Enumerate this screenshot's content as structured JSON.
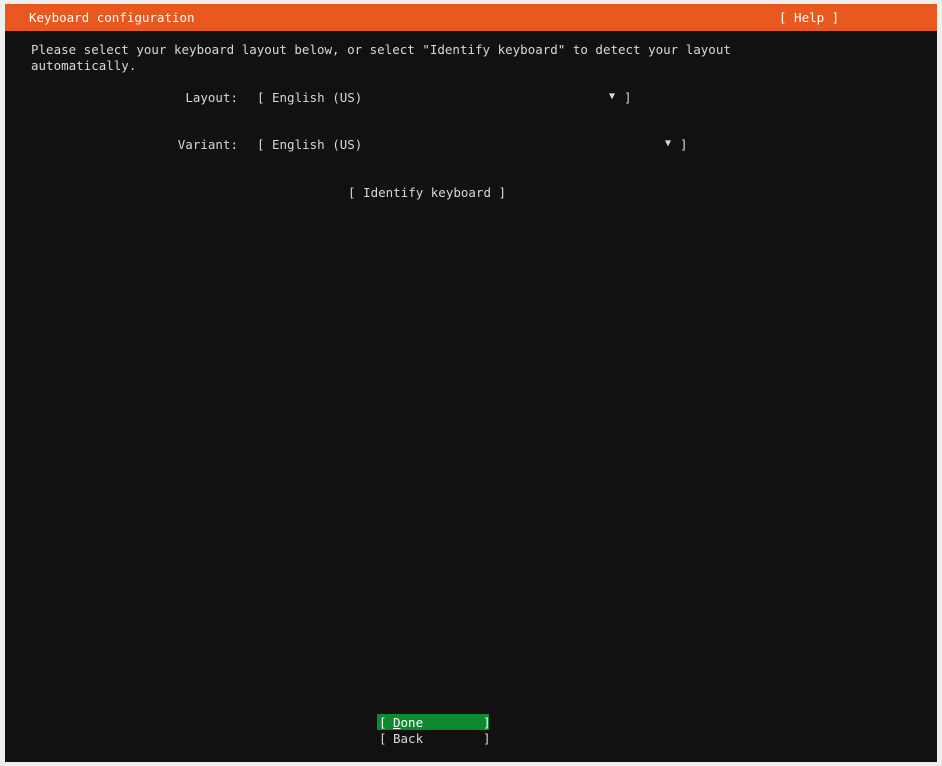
{
  "header": {
    "title": "Keyboard configuration",
    "help_label": "[ Help ]"
  },
  "intro_text": "Please select your keyboard layout below, or select \"Identify keyboard\" to detect your layout\nautomatically.",
  "layout": {
    "label": "Layout:",
    "value": "English (US)"
  },
  "variant": {
    "label": "Variant:",
    "value": "English (US)"
  },
  "identify_button": "[ Identify keyboard ]",
  "buttons": {
    "done_first": "D",
    "done_rest": "one",
    "back_label": "Back"
  },
  "colors": {
    "header_bg": "#e9581f",
    "focused_button_bg": "#0d8a2f",
    "screen_bg": "#111111"
  }
}
